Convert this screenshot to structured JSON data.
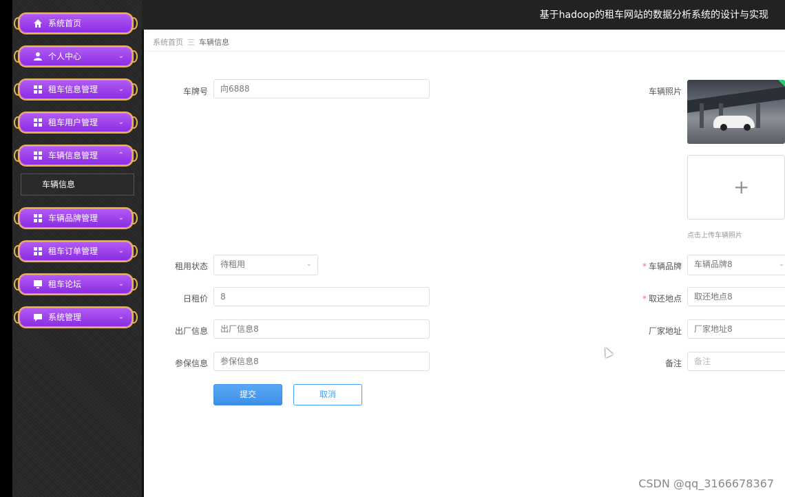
{
  "header": {
    "title": "基于hadoop的租车网站的数据分析系统的设计与实现"
  },
  "sidebar": {
    "items": [
      {
        "label": "系统首页",
        "icon": "home-icon",
        "arrow": ""
      },
      {
        "label": "个人中心",
        "icon": "user-icon",
        "arrow": "⌄"
      },
      {
        "label": "租车信息管理",
        "icon": "grid-icon",
        "arrow": "⌄"
      },
      {
        "label": "租车用户管理",
        "icon": "grid-icon",
        "arrow": "⌄"
      },
      {
        "label": "车辆信息管理",
        "icon": "grid-icon",
        "arrow": "⌃"
      },
      {
        "label": "车辆品牌管理",
        "icon": "grid-icon",
        "arrow": "⌄"
      },
      {
        "label": "租车订单管理",
        "icon": "grid-icon",
        "arrow": "⌄"
      },
      {
        "label": "租车论坛",
        "icon": "monitor-icon",
        "arrow": "⌄"
      },
      {
        "label": "系统管理",
        "icon": "chat-icon",
        "arrow": "⌄"
      }
    ],
    "sub_item": "车辆信息"
  },
  "breadcrumb": {
    "home": "系统首页",
    "separator": "三",
    "current": "车辆信息"
  },
  "form": {
    "plate": {
      "label": "车牌号",
      "value": "向6888"
    },
    "photo": {
      "label": "车辆照片",
      "upload_hint": "点击上传车辆照片"
    },
    "status": {
      "label": "租用状态",
      "value": "待租用"
    },
    "brand": {
      "label": "车辆品牌",
      "value": "车辆品牌8"
    },
    "daily_price": {
      "label": "日租价",
      "value": "8"
    },
    "pickup": {
      "label": "取还地点",
      "value": "取还地点8"
    },
    "factory_info": {
      "label": "出厂信息",
      "value": "出厂信息8"
    },
    "factory_addr": {
      "label": "厂家地址",
      "value": "厂家地址8"
    },
    "insurance": {
      "label": "参保信息",
      "value": "参保信息8"
    },
    "remark": {
      "label": "备注",
      "placeholder": "备注"
    }
  },
  "buttons": {
    "submit": "提交",
    "cancel": "取消"
  },
  "watermark": "CSDN @qq_3166678367",
  "colors": {
    "menu_purple": "#9b3ff0",
    "menu_border": "#e9b44c",
    "primary": "#409eff",
    "required": "#f56c6c"
  }
}
